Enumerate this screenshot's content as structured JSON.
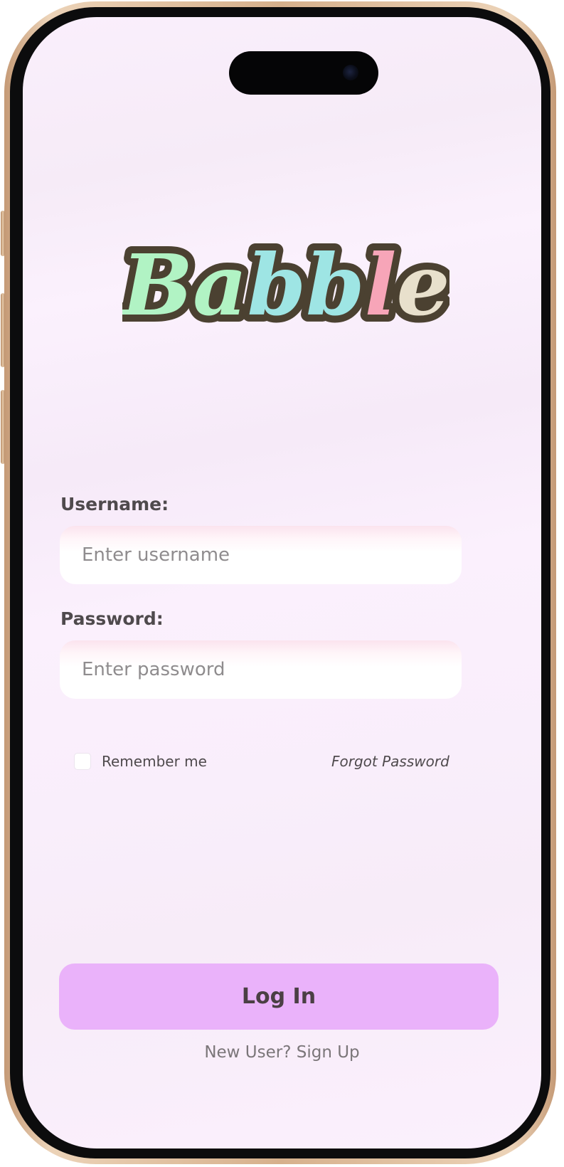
{
  "app": {
    "logo_text": "Babble",
    "logo_letter_colors": [
      "#b1f3c4",
      "#b1f3c4",
      "#9ee5e4",
      "#9ee5e4",
      "#f7a5b8",
      "#e8e0cc"
    ],
    "logo_outline_color": "#4b4131"
  },
  "login_form": {
    "username_label": "Username:",
    "username_placeholder": "Enter username",
    "username_value": "",
    "password_label": "Password:",
    "password_placeholder": "Enter password",
    "password_value": "",
    "remember_me_label": "Remember me",
    "remember_me_checked": false,
    "forgot_password_label": "Forgot Password",
    "login_button_label": "Log In",
    "signup_link_label": "New User? Sign Up"
  },
  "colors": {
    "background": "#faeffc",
    "button": "#eab2fa",
    "label_text": "#4f4a4d",
    "placeholder_text": "#8f8c8e"
  }
}
